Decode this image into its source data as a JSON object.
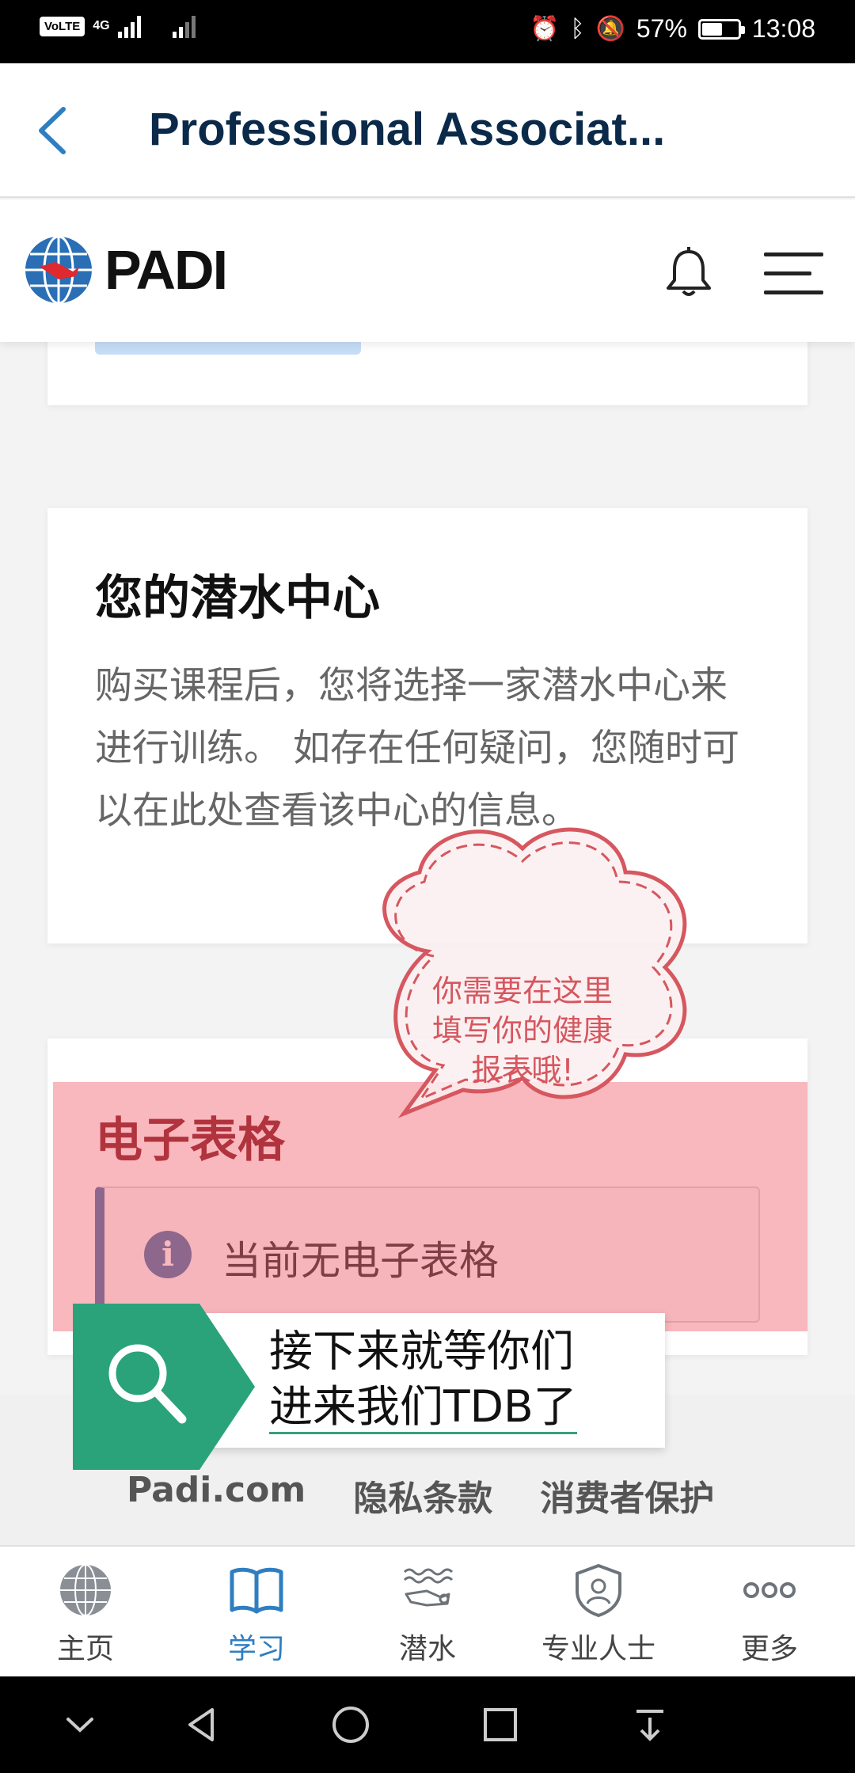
{
  "status_bar": {
    "volte": "VoLTE",
    "network": "4G",
    "battery_percent": "57%",
    "time": "13:08",
    "battery_level": 0.57
  },
  "title_bar": {
    "title": "Professional Associat..."
  },
  "padi_header": {
    "logo_text": "PADI"
  },
  "dive_center_card": {
    "title": "您的潜水中心",
    "body": "购买课程后，您将选择一家潜水中心来进行训练。 如存在任何疑问，您随时可以在此处查看该中心的信息。"
  },
  "speech_bubble": {
    "text_line1": "你需要在这里",
    "text_line2": "填写你的健康",
    "text_line3": "报表哦!"
  },
  "forms_card": {
    "title": "电子表格",
    "info_text": "当前无电子表格"
  },
  "banner": {
    "line1": "接下来就等你们",
    "line2": "进来我们TDB了"
  },
  "footer": {
    "links": [
      "Padi.com",
      "隐私条款",
      "消费者保护"
    ]
  },
  "tabs": [
    {
      "label": "主页",
      "icon": "globe-icon"
    },
    {
      "label": "学习",
      "icon": "book-icon",
      "active": true
    },
    {
      "label": "潜水",
      "icon": "diver-icon"
    },
    {
      "label": "专业人士",
      "icon": "badge-icon"
    },
    {
      "label": "更多",
      "icon": "more-icon"
    }
  ],
  "colors": {
    "title_navy": "#0b2a4a",
    "active_tab": "#2f7ec1",
    "forms_title": "#7a0f14",
    "highlight": "#f25f6e",
    "banner_green": "#2aa37a"
  }
}
